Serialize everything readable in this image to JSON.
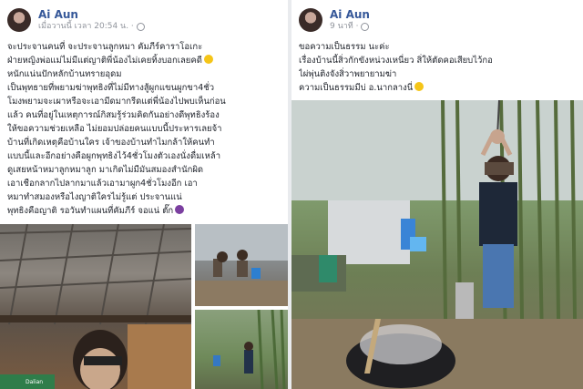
{
  "left_post": {
    "author": "Ai Aun",
    "timestamp": "เมื่อวานนี้ เวลา 20:54 น. ·",
    "lines": [
      "ฺจะประจานคนที่ จะประจานลูกหมา คัมภีร์คาราโอเกะ",
      "ฝ่ายหญิงพ่อแม่ไม่มีแต่ญาติพี่น้องไม่เคยทิ้งบอกเลยคดี",
      "หนักแน่นปักหลักบ้านทรายอุดม",
      "เป็นพุทธายที่พยามฆ่าพุทธิงที่ไม่มีทางสู้ผูกแขนผูกขา4ชั่ว",
      "โมงพยามจะเผาหรือจะเอามีดมากรีดแต่พี่น้องไปพบเห็นก่อน",
      "แล้ว คนที่อยู่ในเหตุการณ์กิสมรู้ร่วมคิดกันอย่างดีพุทธิงร้อง",
      "ให้ขอความช่วยเหลือ ไม่ยอมปล่อยคนแบบนี้ประหารเลยจ้า",
      "บ้านที่เกิดเหตุคือบ้านใคร เจ้าของบ้านทำไมกล้าให้คนทำ",
      "แบบนี้และอีกอย่างคือผูกพุทธิงไว้4ชั่วโมงตัวเองนั่งดื่มเหล้า",
      "ดูเสยหน้าหมาลูกหมาลูก มาเกิดไม่มีมันสมองสำนักผิด",
      "เอาเชือกลากไปลากมาแล้วเอามาผูก4ชั่วโมงอีก เอา",
      "หมาทำสมองหรือไงญาติใครไม่รู้แต่ ประจานแน่",
      "พุทธิงคือญาติ รอวันทำแผนที่คัมภีร์ จอแน่ ตั๊ก"
    ]
  },
  "right_post": {
    "author": "Ai Aun",
    "timestamp": "9 นาที ·",
    "lines": [
      "ขอความเป็นธรรม นะค่ะ",
      "เรื่องบ้านนี้สิ่วกักขังหน่วงเหนี่ยว สิ่ให้ตัดคอเสียบไว้กอ",
      "ไผ่พุ่นติงจังสิ่วาพยายามฆ่า",
      "ความเป็นธรรมมีบ่ อ.นากลางนี่"
    ]
  },
  "photo_captions": {
    "shirt_text": "Dalian"
  },
  "colors": {
    "link": "#365899",
    "text": "#1d2129",
    "meta": "#90949c"
  }
}
